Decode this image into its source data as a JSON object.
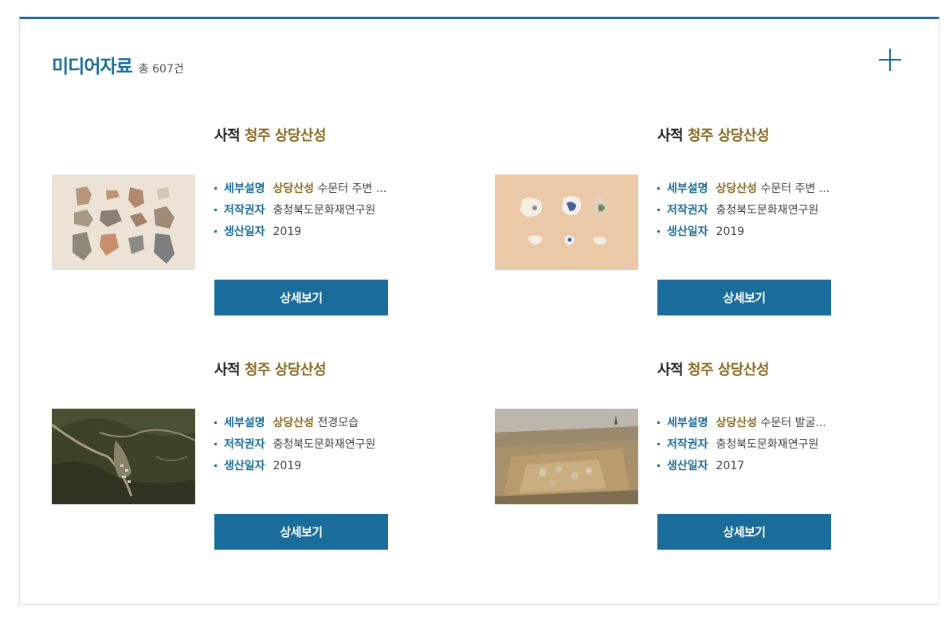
{
  "header": {
    "title": "미디어자료",
    "total": "총 607건",
    "more_icon": "plus-icon"
  },
  "cards": [
    {
      "title_prefix": "사적",
      "title_highlight": "청주 상당산성",
      "desc_label": "세부설명",
      "desc_highlight": "상당산성",
      "desc_rest": " 수문터 주변 ...",
      "author_label": "저작권자",
      "author": "충청북도문화재연구원",
      "date_label": "생산일자",
      "date": "2019",
      "button": "상세보기",
      "thumb": "pottery-shards-photo"
    },
    {
      "title_prefix": "사적",
      "title_highlight": "청주 상당산성",
      "desc_label": "세부설명",
      "desc_highlight": "상당산성",
      "desc_rest": " 수문터 주변 ...",
      "author_label": "저작권자",
      "author": "충청북도문화재연구원",
      "date_label": "생산일자",
      "date": "2019",
      "button": "상세보기",
      "thumb": "porcelain-fragments-photo"
    },
    {
      "title_prefix": "사적",
      "title_highlight": "청주 상당산성",
      "desc_label": "세부설명",
      "desc_highlight": "상당산성",
      "desc_rest": " 전경모습",
      "author_label": "저작권자",
      "author": "충청북도문화재연구원",
      "date_label": "생산일자",
      "date": "2019",
      "button": "상세보기",
      "thumb": "aerial-view-photo"
    },
    {
      "title_prefix": "사적",
      "title_highlight": "청주 상당산성",
      "desc_label": "세부설명",
      "desc_highlight": "상당산성",
      "desc_rest": " 수문터 발굴...",
      "author_label": "저작권자",
      "author": "충청북도문화재연구원",
      "date_label": "생산일자",
      "date": "2017",
      "button": "상세보기",
      "thumb": "excavation-site-photo"
    }
  ],
  "colors": {
    "accent": "#1a6d9a",
    "highlight": "#8a6a22"
  }
}
